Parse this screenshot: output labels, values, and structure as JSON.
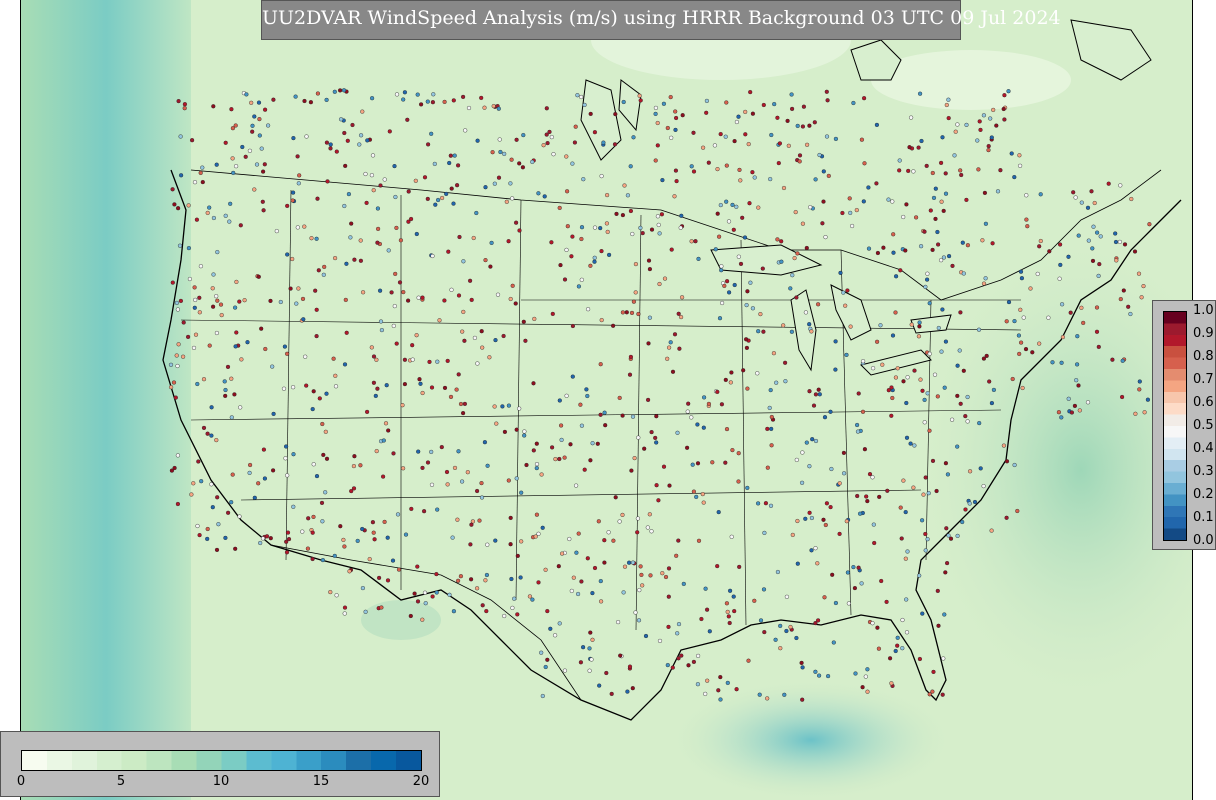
{
  "title": "UU2DVAR WindSpeed Analysis (m/s) using HRRR Background 03 UTC 09 Jul 2024",
  "map": {
    "field": "wind speed",
    "units": "m/s",
    "region": "CONUS",
    "shaded_field_colors": [
      "#f7fcf0",
      "#e0f3db",
      "#ccebc5",
      "#a8ddb5",
      "#7bccc4",
      "#4eb3d3",
      "#2b8cbe",
      "#08589e"
    ],
    "observation_marker": "small circles colored by QC value",
    "borders": "state and country boundaries, coastlines"
  },
  "qc_colorbar": {
    "ticks": [
      "1.0",
      "0.9",
      "0.8",
      "0.7",
      "0.6",
      "0.5",
      "0.4",
      "0.3",
      "0.2",
      "0.1",
      "0.0"
    ],
    "colors": [
      "#67001f",
      "#9c1a2e",
      "#b2182b",
      "#c9503f",
      "#d6604d",
      "#e48c6f",
      "#f4a582",
      "#f7c6ac",
      "#fddbc7",
      "#f2ece7",
      "#f7f7f7",
      "#e3eef5",
      "#d1e5f0",
      "#a9cde4",
      "#92c5de",
      "#6aaed2",
      "#4393c3",
      "#2f76b6",
      "#2166ac",
      "#134a85"
    ]
  },
  "windspeed_colorbar": {
    "ticks": [
      "0",
      "5",
      "10",
      "15",
      "20"
    ],
    "range": [
      0,
      20
    ],
    "colors": [
      "#f7fcf0",
      "#eaf7e4",
      "#e0f3db",
      "#d5efcf",
      "#ccebc5",
      "#bde5bf",
      "#a8ddb5",
      "#93d4b9",
      "#7bccc4",
      "#5cbcd0",
      "#4eb3d3",
      "#3a9fc9",
      "#2b8cbe",
      "#1c6fa8",
      "#0868ac",
      "#08589e"
    ]
  }
}
